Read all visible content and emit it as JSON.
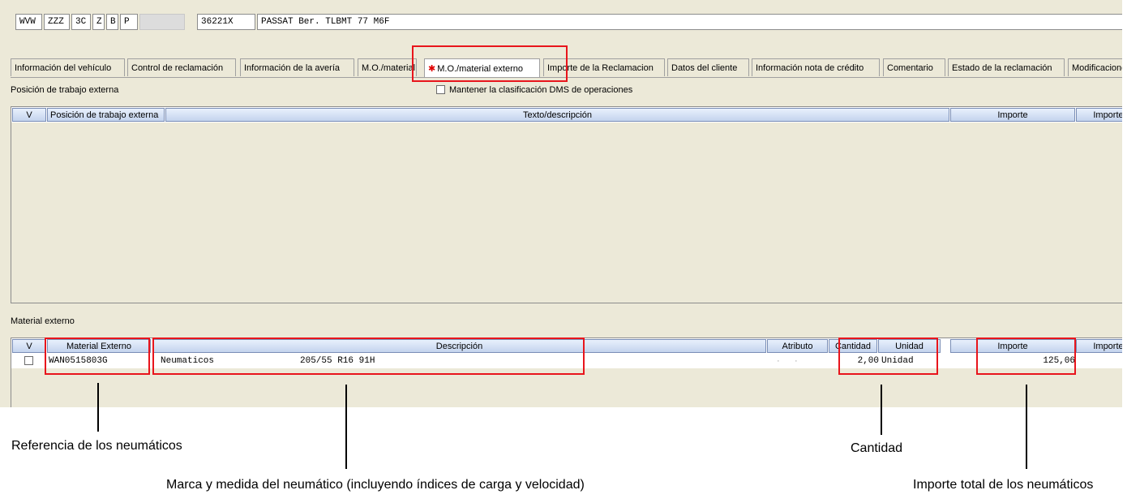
{
  "header": {
    "codes": [
      "WVW",
      "ZZZ",
      "3C",
      "Z",
      "B",
      "P"
    ],
    "number": "36221X",
    "vehicle": "PASSAT Ber. TLBMT 77 M6F"
  },
  "tabs": [
    {
      "label": "Información del vehículo"
    },
    {
      "label": "Control de reclamación"
    },
    {
      "label": "Información de la avería"
    },
    {
      "label": "M.O./material"
    },
    {
      "label": "M.O./material externo",
      "marker": "✱"
    },
    {
      "label": "Importe de la Reclamacion"
    },
    {
      "label": "Datos del cliente"
    },
    {
      "label": "Información nota de crédito"
    },
    {
      "label": "Comentario"
    },
    {
      "label": "Estado de la reclamación"
    },
    {
      "label": "Modificaciones"
    }
  ],
  "external_work": {
    "section_label": "Posición de trabajo externa",
    "checkbox_label": "Mantener la clasificación DMS de operaciones",
    "columns": [
      "V",
      "Posición de trabajo externa",
      "Texto/descripción",
      "Importe",
      "Importe"
    ]
  },
  "external_material": {
    "section_label": "Material externo",
    "columns": [
      "V",
      "Material Externo",
      "Descripción",
      "Atributo",
      "Cantidad",
      "Unidad",
      "Importe",
      "Importe"
    ],
    "rows": [
      {
        "material": "WAN0515803G",
        "description": "Neumaticos",
        "size": "205/55 R16 91H",
        "quantity": "2,00",
        "unit": "Unidad",
        "amount": "125,06"
      }
    ]
  },
  "annotations": {
    "reference": "Referencia de los neumáticos",
    "brand_size": "Marca y medida del neumático (incluyendo índices de carga y velocidad)",
    "quantity": "Cantidad",
    "total": "Importe total de los neumáticos"
  }
}
